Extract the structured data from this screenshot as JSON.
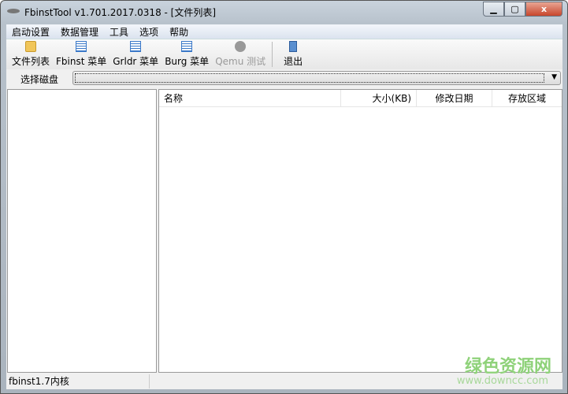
{
  "window": {
    "title": "FbinstTool v1.701.2017.0318 - [文件列表]",
    "min": "▁",
    "max": "▢",
    "close": "x"
  },
  "menu": [
    "启动设置",
    "数据管理",
    "工具",
    "选项",
    "帮助"
  ],
  "toolbar": [
    {
      "label": "文件列表",
      "icon": "folder-icon"
    },
    {
      "label": "Fbinst 菜单",
      "icon": "document-icon"
    },
    {
      "label": "Grldr 菜单",
      "icon": "document-icon"
    },
    {
      "label": "Burg 菜单",
      "icon": "document-icon"
    },
    {
      "label": "Qemu 测试",
      "icon": "disc-icon",
      "disabled": true
    },
    {
      "label": "退出",
      "icon": "exit-icon"
    }
  ],
  "disk": {
    "label": "选择磁盘",
    "value": "",
    "arrow": "▼"
  },
  "columns": [
    "名称",
    "大小(KB)",
    "修改日期",
    "存放区域"
  ],
  "status": "fbinst1.7内核",
  "watermark": {
    "name": "绿色资源网",
    "url": "www.downcc.com"
  }
}
